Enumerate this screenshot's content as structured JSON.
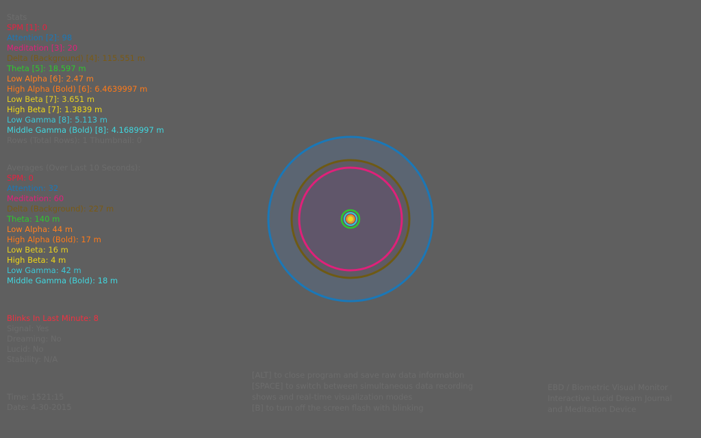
{
  "colors": {
    "background": "#5f5f5f",
    "dim": "#6c6c6c",
    "spm": "#e82040",
    "attention": "#1a78b8",
    "meditation": "#e0207a",
    "delta": "#7a5a14",
    "theta": "#2ec82e",
    "low_alpha": "#ff8020",
    "high_alpha": "#ff7a18",
    "low_beta": "#e8d020",
    "high_beta": "#f0d818",
    "low_gamma": "#3cc8d8",
    "mid_gamma": "#40d8e0",
    "blinks": "#f03040"
  },
  "stats": {
    "header": "Stats",
    "spm": "SPM [1]: 0",
    "attention": "Attention [2]: 98",
    "meditation": "Meditation [3]: 20",
    "delta": "Delta (Background) [4]: 115.551 m",
    "theta": "Theta [5]: 18.597 m",
    "low_alpha": "Low Alpha [6]: 2.47 m",
    "high_alpha": "High Alpha (Bold) [6]: 6.4639997 m",
    "low_beta": "Low Beta [7]: 3.651 m",
    "high_beta": "High Beta [7]: 1.3839 m",
    "low_gamma": "Low Gamma [8]: 5.113 m",
    "mid_gamma": "Middle Gamma (Bold) [8]: 4.1689997 m",
    "footer": "Rows (Total Rows): 1 Thumbnail: 0"
  },
  "averages": {
    "header": "Averages (Over Last 10 Seconds):",
    "spm": "SPM: 0",
    "attention": "Attention: 32",
    "meditation": "Meditation: 60",
    "delta": "Delta (Background): 227 m",
    "theta": "Theta: 140 m",
    "low_alpha": "Low Alpha: 44 m",
    "high_alpha": "High Alpha (Bold): 17 m",
    "low_beta": "Low Beta: 16 m",
    "high_beta": "High Beta: 4 m",
    "low_gamma": "Low Gamma: 42 m",
    "mid_gamma": "Middle Gamma (Bold): 18 m"
  },
  "status": {
    "blinks": "Blinks In Last Minute: 8",
    "line1": "Signal: Yes",
    "line2": "Dreaming: No",
    "line3": "Lucid: No",
    "line4": "Stability: N/A"
  },
  "time": {
    "time": "Time: 1521:15",
    "date": "Date: 4-30-2015"
  },
  "instructions": {
    "line1": "[ALT] to close program and save raw data information",
    "line2": "[SPACE] to switch between simultaneous data recording",
    "line3": "shows and real-time visualization modes",
    "line4": "[B] to turn off the screen flash with blinking"
  },
  "about": {
    "line1": "EBD / Biometric Visual Monitor",
    "line2": "Interactive Lucid Dream Journal",
    "line3": "and Meditation Device"
  }
}
